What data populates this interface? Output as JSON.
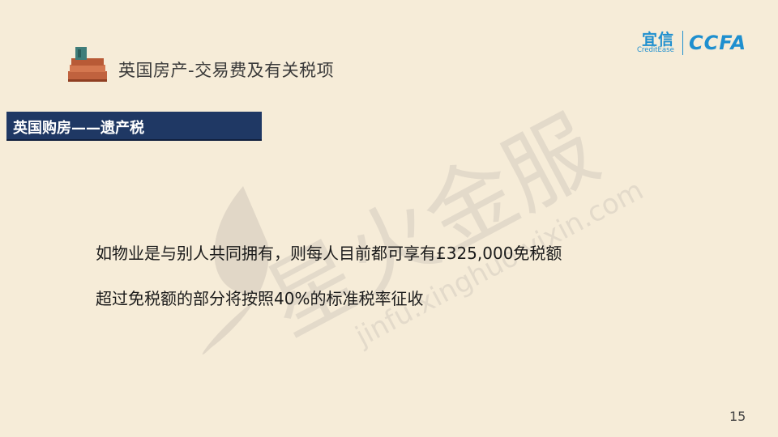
{
  "header": {
    "title": "英国房产-交易费及有关税项",
    "icon": "books-icon"
  },
  "logo": {
    "brand_cn": "宜信",
    "brand_en": "CreditEase",
    "partner": "CCFA",
    "color": "#1e8fcf"
  },
  "banner": {
    "text": "英国购房——遗产税",
    "color": "#1f3864"
  },
  "body": {
    "lines": [
      "如物业是与别人共同拥有，则每人目前都可享有£325,000免税额",
      "超过免税额的部分将按照40%的标准税率征收"
    ]
  },
  "watermark": {
    "cn": "星火金服",
    "url": "jinfu.xinghuo.vixin.com"
  },
  "footer": {
    "page_number": "15"
  },
  "colors": {
    "background": "#f6ecd8",
    "watermark": "#d9d0c2"
  }
}
